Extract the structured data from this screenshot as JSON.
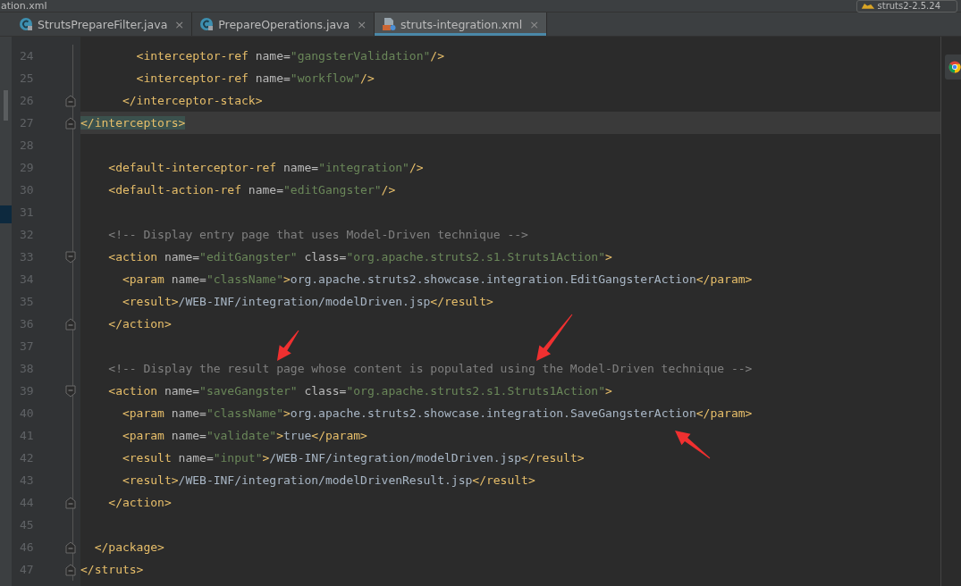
{
  "top_strip": {
    "file_title": "ation.xml",
    "run_config": "struts2-2.5.24"
  },
  "tabs": [
    {
      "label": "StrutsPrepareFilter.java",
      "kind": "java",
      "close": "×",
      "selected": false
    },
    {
      "label": "PrepareOperations.java",
      "kind": "java",
      "close": "×",
      "selected": false
    },
    {
      "label": "struts-integration.xml",
      "kind": "xml",
      "close": "×",
      "selected": true
    }
  ],
  "lines": [
    {
      "number": "24",
      "kind": "plain",
      "current": false,
      "tokens": [
        {
          "kind": "tag",
          "text": "        <interceptor-ref"
        },
        {
          "kind": "attr",
          "text": " name="
        },
        {
          "kind": "val",
          "text": "\"gangsterValidation\""
        },
        {
          "kind": "tag",
          "text": "/>"
        }
      ]
    },
    {
      "number": "25",
      "kind": "plain",
      "current": false,
      "tokens": [
        {
          "kind": "tag",
          "text": "        <interceptor-ref"
        },
        {
          "kind": "attr",
          "text": " name="
        },
        {
          "kind": "val",
          "text": "\"workflow\""
        },
        {
          "kind": "tag",
          "text": "/>"
        }
      ]
    },
    {
      "number": "26",
      "kind": "fold_end",
      "current": false,
      "tokens": [
        {
          "kind": "tag",
          "text": "      </interceptor-stack>"
        }
      ]
    },
    {
      "number": "27",
      "kind": "fold_end",
      "current": true,
      "tokens": [
        {
          "kind": "matched_tag",
          "text": "</interceptors>"
        }
      ]
    },
    {
      "number": "28",
      "kind": "plain",
      "current": false
    },
    {
      "number": "29",
      "kind": "plain",
      "current": false,
      "tokens": [
        {
          "kind": "tag",
          "text": "    <default-interceptor-ref"
        },
        {
          "kind": "attr",
          "text": " name="
        },
        {
          "kind": "val",
          "text": "\"integration\""
        },
        {
          "kind": "tag",
          "text": "/>"
        }
      ]
    },
    {
      "number": "30",
      "kind": "plain",
      "current": false,
      "tokens": [
        {
          "kind": "tag",
          "text": "    <default-action-ref"
        },
        {
          "kind": "attr",
          "text": " name="
        },
        {
          "kind": "val",
          "text": "\"editGangster\""
        },
        {
          "kind": "tag",
          "text": "/>"
        }
      ]
    },
    {
      "number": "31",
      "kind": "plain",
      "current": false
    },
    {
      "number": "32",
      "kind": "plain",
      "current": false,
      "tokens": [
        {
          "kind": "comment",
          "text": "    <!-- Display entry page that uses Model-Driven technique -->"
        }
      ]
    },
    {
      "number": "33",
      "kind": "fold_start",
      "current": false,
      "tokens": [
        {
          "kind": "tag",
          "text": "    <action"
        },
        {
          "kind": "attr",
          "text": " name="
        },
        {
          "kind": "val",
          "text": "\"editGangster\""
        },
        {
          "kind": "attr",
          "text": " class="
        },
        {
          "kind": "val",
          "text": "\"org.apache.struts2.s1.Struts1Action\""
        },
        {
          "kind": "tag",
          "text": ">"
        }
      ]
    },
    {
      "number": "34",
      "kind": "plain",
      "current": false,
      "tokens": [
        {
          "kind": "tag",
          "text": "      <param"
        },
        {
          "kind": "attr",
          "text": " name="
        },
        {
          "kind": "val",
          "text": "\"className\""
        },
        {
          "kind": "tag",
          "text": ">"
        },
        {
          "kind": "text",
          "text": "org.apache.struts2.showcase.integration.EditGangsterAction"
        },
        {
          "kind": "tag",
          "text": "</param>"
        }
      ]
    },
    {
      "number": "35",
      "kind": "plain",
      "current": false,
      "tokens": [
        {
          "kind": "tag",
          "text": "      <result>"
        },
        {
          "kind": "text",
          "text": "/WEB-INF/integration/modelDriven.jsp"
        },
        {
          "kind": "tag",
          "text": "</result>"
        }
      ]
    },
    {
      "number": "36",
      "kind": "fold_end",
      "current": false,
      "tokens": [
        {
          "kind": "tag",
          "text": "    </action>"
        }
      ]
    },
    {
      "number": "37",
      "kind": "plain",
      "current": false
    },
    {
      "number": "38",
      "kind": "plain",
      "current": false,
      "tokens": [
        {
          "kind": "comment",
          "text": "    <!-- Display the result page whose content is populated using the Model-Driven technique -->"
        }
      ]
    },
    {
      "number": "39",
      "kind": "fold_start",
      "current": false,
      "tokens": [
        {
          "kind": "tag",
          "text": "    <action"
        },
        {
          "kind": "attr",
          "text": " name="
        },
        {
          "kind": "val",
          "text": "\"saveGangster\""
        },
        {
          "kind": "attr",
          "text": " class="
        },
        {
          "kind": "val",
          "text": "\"org.apache.struts2.s1.Struts1Action\""
        },
        {
          "kind": "tag",
          "text": ">"
        }
      ]
    },
    {
      "number": "40",
      "kind": "plain",
      "current": false,
      "tokens": [
        {
          "kind": "tag",
          "text": "      <param"
        },
        {
          "kind": "attr",
          "text": " name="
        },
        {
          "kind": "val",
          "text": "\"className\""
        },
        {
          "kind": "tag",
          "text": ">"
        },
        {
          "kind": "text",
          "text": "org.apache.struts2.showcase.integration.SaveGangsterAction"
        },
        {
          "kind": "tag",
          "text": "</param>"
        }
      ]
    },
    {
      "number": "41",
      "kind": "plain",
      "current": false,
      "tokens": [
        {
          "kind": "tag",
          "text": "      <param"
        },
        {
          "kind": "attr",
          "text": " name="
        },
        {
          "kind": "val",
          "text": "\"validate\""
        },
        {
          "kind": "tag",
          "text": ">"
        },
        {
          "kind": "text",
          "text": "true"
        },
        {
          "kind": "tag",
          "text": "</param>"
        }
      ]
    },
    {
      "number": "42",
      "kind": "plain",
      "current": false,
      "tokens": [
        {
          "kind": "tag",
          "text": "      <result"
        },
        {
          "kind": "attr",
          "text": " name="
        },
        {
          "kind": "val",
          "text": "\"input\""
        },
        {
          "kind": "tag",
          "text": ">"
        },
        {
          "kind": "text",
          "text": "/WEB-INF/integration/modelDriven.jsp"
        },
        {
          "kind": "tag",
          "text": "</result>"
        }
      ]
    },
    {
      "number": "43",
      "kind": "plain",
      "current": false,
      "tokens": [
        {
          "kind": "tag",
          "text": "      <result>"
        },
        {
          "kind": "text",
          "text": "/WEB-INF/integration/modelDrivenResult.jsp"
        },
        {
          "kind": "tag",
          "text": "</result>"
        }
      ]
    },
    {
      "number": "44",
      "kind": "fold_end",
      "current": false,
      "tokens": [
        {
          "kind": "tag",
          "text": "    </action>"
        }
      ]
    },
    {
      "number": "45",
      "kind": "plain",
      "current": false
    },
    {
      "number": "46",
      "kind": "fold_end",
      "current": false,
      "tokens": [
        {
          "kind": "tag",
          "text": "  </package>"
        }
      ]
    },
    {
      "number": "47",
      "kind": "fold_end",
      "current": false,
      "tokens": [
        {
          "kind": "tag",
          "text": "</struts>"
        }
      ]
    }
  ]
}
